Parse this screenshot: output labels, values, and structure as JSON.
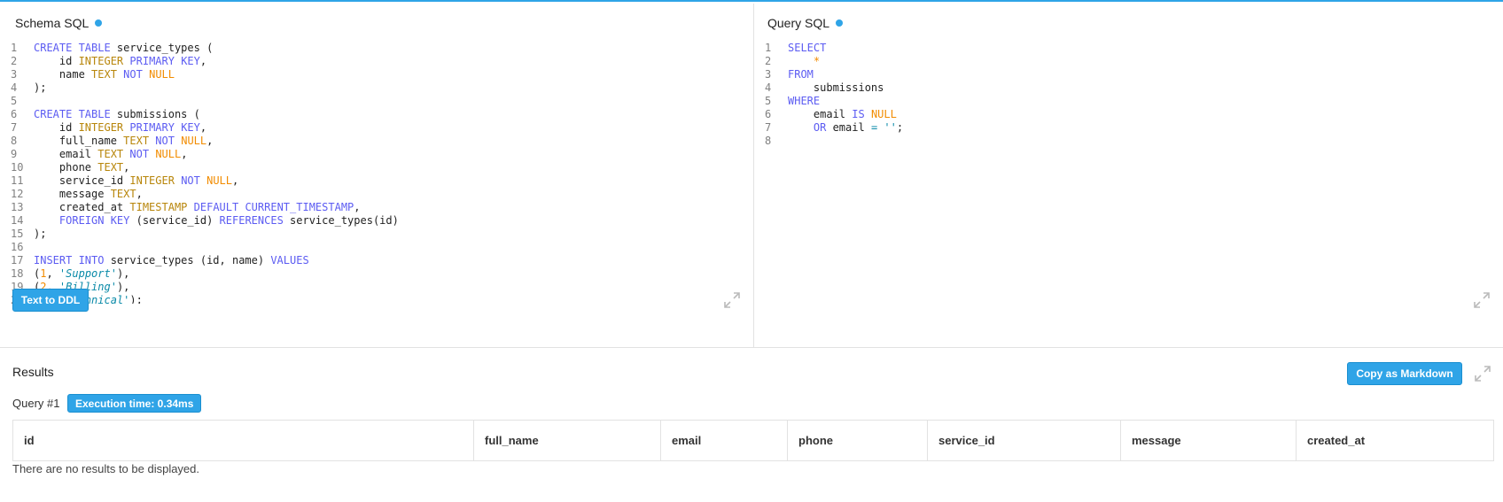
{
  "schema_pane": {
    "title": "Schema SQL",
    "button_label": "Text to DDL",
    "lines": [
      [
        {
          "t": "CREATE TABLE",
          "c": "kw"
        },
        {
          "t": " service_types (",
          "c": ""
        }
      ],
      [
        {
          "t": "    id ",
          "c": ""
        },
        {
          "t": "INTEGER",
          "c": "ty"
        },
        {
          "t": " ",
          "c": ""
        },
        {
          "t": "PRIMARY KEY",
          "c": "kw"
        },
        {
          "t": ",",
          "c": ""
        }
      ],
      [
        {
          "t": "    name ",
          "c": ""
        },
        {
          "t": "TEXT",
          "c": "ty"
        },
        {
          "t": " ",
          "c": ""
        },
        {
          "t": "NOT",
          "c": "kw"
        },
        {
          "t": " ",
          "c": ""
        },
        {
          "t": "NULL",
          "c": "nl"
        }
      ],
      [
        {
          "t": ");",
          "c": ""
        }
      ],
      [],
      [
        {
          "t": "CREATE TABLE",
          "c": "kw"
        },
        {
          "t": " submissions (",
          "c": ""
        }
      ],
      [
        {
          "t": "    id ",
          "c": ""
        },
        {
          "t": "INTEGER",
          "c": "ty"
        },
        {
          "t": " ",
          "c": ""
        },
        {
          "t": "PRIMARY KEY",
          "c": "kw"
        },
        {
          "t": ",",
          "c": ""
        }
      ],
      [
        {
          "t": "    full_name ",
          "c": ""
        },
        {
          "t": "TEXT",
          "c": "ty"
        },
        {
          "t": " ",
          "c": ""
        },
        {
          "t": "NOT",
          "c": "kw"
        },
        {
          "t": " ",
          "c": ""
        },
        {
          "t": "NULL",
          "c": "nl"
        },
        {
          "t": ",",
          "c": ""
        }
      ],
      [
        {
          "t": "    email ",
          "c": ""
        },
        {
          "t": "TEXT",
          "c": "ty"
        },
        {
          "t": " ",
          "c": ""
        },
        {
          "t": "NOT",
          "c": "kw"
        },
        {
          "t": " ",
          "c": ""
        },
        {
          "t": "NULL",
          "c": "nl"
        },
        {
          "t": ",",
          "c": ""
        }
      ],
      [
        {
          "t": "    phone ",
          "c": ""
        },
        {
          "t": "TEXT",
          "c": "ty"
        },
        {
          "t": ",",
          "c": ""
        }
      ],
      [
        {
          "t": "    service_id ",
          "c": ""
        },
        {
          "t": "INTEGER",
          "c": "ty"
        },
        {
          "t": " ",
          "c": ""
        },
        {
          "t": "NOT",
          "c": "kw"
        },
        {
          "t": " ",
          "c": ""
        },
        {
          "t": "NULL",
          "c": "nl"
        },
        {
          "t": ",",
          "c": ""
        }
      ],
      [
        {
          "t": "    message ",
          "c": ""
        },
        {
          "t": "TEXT",
          "c": "ty"
        },
        {
          "t": ",",
          "c": ""
        }
      ],
      [
        {
          "t": "    created_at ",
          "c": ""
        },
        {
          "t": "TIMESTAMP",
          "c": "ty"
        },
        {
          "t": " ",
          "c": ""
        },
        {
          "t": "DEFAULT",
          "c": "kw"
        },
        {
          "t": " ",
          "c": ""
        },
        {
          "t": "CURRENT_TIMESTAMP",
          "c": "kw"
        },
        {
          "t": ",",
          "c": ""
        }
      ],
      [
        {
          "t": "    ",
          "c": ""
        },
        {
          "t": "FOREIGN KEY",
          "c": "kw"
        },
        {
          "t": " (service_id) ",
          "c": ""
        },
        {
          "t": "REFERENCES",
          "c": "kw"
        },
        {
          "t": " service_types(id)",
          "c": ""
        }
      ],
      [
        {
          "t": ");",
          "c": ""
        }
      ],
      [],
      [
        {
          "t": "INSERT INTO",
          "c": "kw"
        },
        {
          "t": " service_types (id, name) ",
          "c": ""
        },
        {
          "t": "VALUES",
          "c": "kw"
        }
      ],
      [
        {
          "t": "(",
          "c": ""
        },
        {
          "t": "1",
          "c": "nl"
        },
        {
          "t": ", ",
          "c": ""
        },
        {
          "t": "'Support'",
          "c": "str"
        },
        {
          "t": "),",
          "c": ""
        }
      ],
      [
        {
          "t": "(",
          "c": ""
        },
        {
          "t": "2",
          "c": "nl"
        },
        {
          "t": ", ",
          "c": ""
        },
        {
          "t": "'Billing'",
          "c": "str"
        },
        {
          "t": "),",
          "c": ""
        }
      ],
      [
        {
          "t": "(",
          "c": ""
        },
        {
          "t": "3",
          "c": "nl"
        },
        {
          "t": ", ",
          "c": ""
        },
        {
          "t": "'Technical'",
          "c": "str"
        },
        {
          "t": ");",
          "c": ""
        }
      ]
    ]
  },
  "query_pane": {
    "title": "Query SQL",
    "lines": [
      [
        {
          "t": "SELECT",
          "c": "kw"
        }
      ],
      [
        {
          "t": "    ",
          "c": ""
        },
        {
          "t": "*",
          "c": "nl"
        }
      ],
      [
        {
          "t": "FROM",
          "c": "kw"
        }
      ],
      [
        {
          "t": "    submissions",
          "c": ""
        }
      ],
      [
        {
          "t": "WHERE",
          "c": "kw"
        }
      ],
      [
        {
          "t": "    email ",
          "c": ""
        },
        {
          "t": "IS",
          "c": "kw"
        },
        {
          "t": " ",
          "c": ""
        },
        {
          "t": "NULL",
          "c": "nl"
        }
      ],
      [
        {
          "t": "    ",
          "c": ""
        },
        {
          "t": "OR",
          "c": "kw"
        },
        {
          "t": " email ",
          "c": ""
        },
        {
          "t": "=",
          "c": "op"
        },
        {
          "t": " ",
          "c": ""
        },
        {
          "t": "''",
          "c": "str"
        },
        {
          "t": ";",
          "c": ""
        }
      ],
      []
    ]
  },
  "results": {
    "title": "Results",
    "copy_button": "Copy as Markdown",
    "query_label": "Query #1",
    "execution_badge": "Execution time: 0.34ms",
    "columns": [
      "id",
      "full_name",
      "email",
      "phone",
      "service_id",
      "message",
      "created_at"
    ],
    "empty_message": "There are no results to be displayed."
  },
  "colors": {
    "accent": "#2fa4e7",
    "keyword": "#5c5cf2",
    "type": "#b8860b",
    "null_number": "#f28c00",
    "string": "#0a8aa8"
  },
  "icons": [
    "expand-icon"
  ]
}
